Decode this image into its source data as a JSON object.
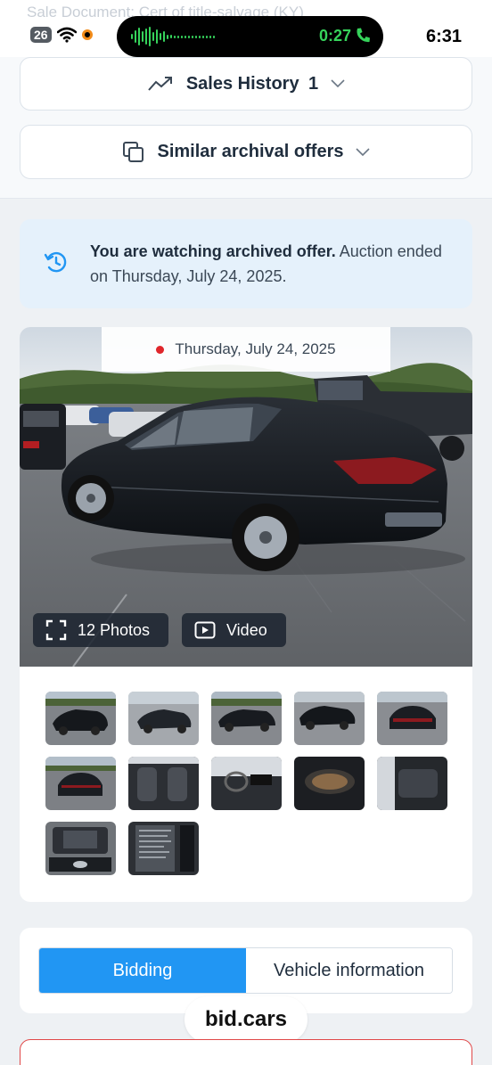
{
  "status_bar": {
    "behind_text_label": "Sale Document:",
    "behind_text_value": "Cert of title-salvage (KY)",
    "battery": "26",
    "call_time": "0:27",
    "clock": "6:31",
    "call_color": "#36d35b",
    "record_color": "#f28c1a"
  },
  "sales_history": {
    "label": "Sales History",
    "count": "1"
  },
  "similar_offers": {
    "label": "Similar archival offers"
  },
  "notice": {
    "bold": "You are watching archived offer.",
    "rest": " Auction ended on Thursday, July 24, 2025."
  },
  "gallery": {
    "date": "Thursday, July 24, 2025",
    "photos_label": "12 Photos",
    "video_label": "Video",
    "thumbnails": [
      "exterior-front-left",
      "exterior-front-right",
      "exterior-side",
      "exterior-left",
      "exterior-rear",
      "exterior-rear-lot",
      "interior-front-seats",
      "dashboard",
      "instrument-cluster",
      "rear-seats",
      "engine-bay",
      "door-sticker"
    ]
  },
  "tabs": {
    "active": "Bidding",
    "inactive": "Vehicle information"
  },
  "watermark": "bid.cars",
  "colors": {
    "accent": "#2196f3",
    "notice_bg": "#e5f1fb",
    "danger": "#e04848",
    "live_dot": "#e0262b"
  }
}
